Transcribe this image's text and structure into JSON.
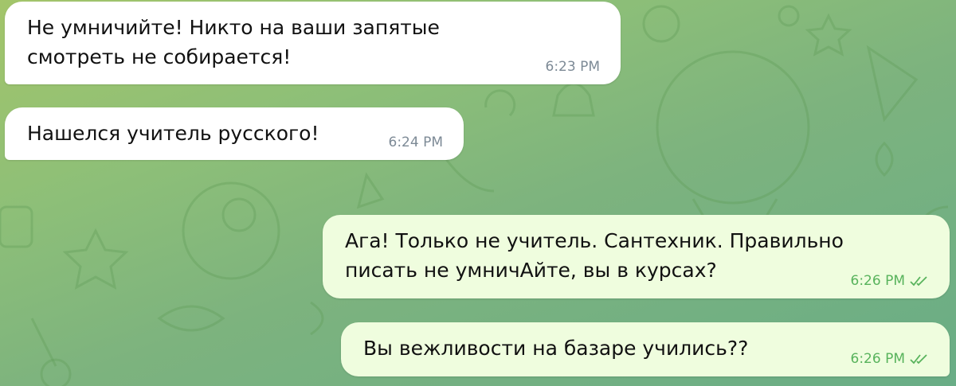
{
  "messages": [
    {
      "direction": "incoming",
      "lines": [
        "Не умничийте! Никто на ваши запятые",
        "смотреть не собирается!"
      ],
      "time": "6:23 PM"
    },
    {
      "direction": "incoming",
      "lines": [
        "Нашелся учитель русского!"
      ],
      "time": "6:24 PM"
    },
    {
      "direction": "outgoing",
      "lines": [
        "Ага! Только не учитель. Сантехник. Правильно",
        "писать не умничАйте, вы в курсах?"
      ],
      "time": "6:26 PM",
      "status_icon": "double-check-icon"
    },
    {
      "direction": "outgoing",
      "lines": [
        "Вы вежливости на базаре учились??"
      ],
      "time": "6:26 PM",
      "status_icon": "double-check-icon"
    }
  ],
  "colors": {
    "incoming_bubble": "#ffffff",
    "outgoing_bubble": "#effdde",
    "incoming_time": "#7d8a96",
    "outgoing_time": "#58b35c",
    "read_check": "#58b35c"
  }
}
